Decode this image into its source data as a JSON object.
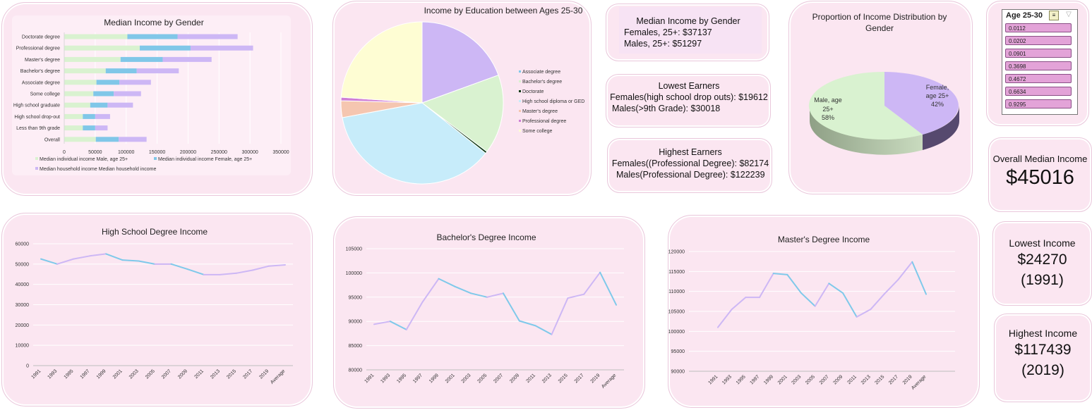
{
  "gender_chart": {
    "title": "Median Income by Gender",
    "categories": [
      "Doctorate degree",
      "Professional degree",
      "Master's degree",
      "Bachelor's degree",
      "Associate degree",
      "Some college",
      "High school graduate",
      "High school drop-out",
      "Less than 9th grade",
      "Overall"
    ],
    "x_ticks": [
      "0",
      "50000",
      "100000",
      "150000",
      "200000",
      "250000",
      "300000",
      "350000"
    ],
    "legend": [
      "Median individual income Male, age 25+",
      "Median individual income Female, age 25+",
      "Median household income Median household income"
    ],
    "colors": [
      "#d9f2d0",
      "#80c7e8",
      "#cdb7f5"
    ]
  },
  "education_pie": {
    "title": "Income by Education between Ages 25-30",
    "legend": [
      "Associate degree",
      "Bachelor's degree",
      "Doctorate",
      "High school diploma or GED",
      "Master's degree",
      "Professional degree",
      "Some college"
    ]
  },
  "median_by_gender": {
    "title": "Median Income by Gender",
    "females": "Females, 25+: $37137",
    "males": "Males, 25+: $51297"
  },
  "lowest_earners": {
    "title": "Lowest Earners",
    "females": "Females(high school drop outs): $19612",
    "males": "Males(>9th Grade): $30018"
  },
  "highest_earners": {
    "title": "Highest Earners",
    "females": "Females((Professional Degree): $82174",
    "males": "Males(Professional Degree): $122239"
  },
  "proportion_pie": {
    "title_line1": "Proportion of Income Distribution by",
    "title_line2": "Gender",
    "male_l1": "Male, age",
    "male_l2": "25+",
    "male_l3": "58%",
    "female_l1": "Female,",
    "female_l2": "age 25+",
    "female_l3": "42%"
  },
  "slicer": {
    "title": "Age 25-30",
    "items": [
      "0.0112",
      "0.0202",
      "0.0901",
      "0.3698",
      "0.4672",
      "0.6634",
      "0.9295"
    ]
  },
  "overall_median": {
    "label": "Overall Median Income",
    "value": "$45016"
  },
  "lowest_income": {
    "label": "Lowest Income",
    "value": "$24270",
    "year": "(1991)"
  },
  "highest_income": {
    "label": "Highest Income",
    "value": "$117439",
    "year": "(2019)"
  },
  "hs_chart": {
    "title": "High School Degree Income",
    "y_ticks": [
      "60000",
      "50000",
      "40000",
      "30000",
      "20000",
      "10000",
      "0"
    ],
    "x_labels": [
      "1991",
      "1993",
      "1995",
      "1997",
      "1999",
      "2001",
      "2003",
      "2005",
      "2007",
      "2009",
      "2011",
      "2013",
      "2015",
      "2017",
      "2019",
      "Average"
    ]
  },
  "ba_chart": {
    "title": "Bachelor's Degree Income",
    "y_ticks": [
      "105000",
      "100000",
      "95000",
      "90000",
      "85000",
      "80000"
    ],
    "x_labels": [
      "1991",
      "1993",
      "1995",
      "1997",
      "1999",
      "2001",
      "2003",
      "2005",
      "2007",
      "2009",
      "2011",
      "2013",
      "2015",
      "2017",
      "2019",
      "Average"
    ]
  },
  "ma_chart": {
    "title": "Master's Degree Income",
    "y_ticks": [
      "120000",
      "115000",
      "110000",
      "105000",
      "100000",
      "95000",
      "90000"
    ],
    "x_labels": [
      "1991",
      "1993",
      "1995",
      "1997",
      "1999",
      "2001",
      "2003",
      "2005",
      "2007",
      "2009",
      "2011",
      "2013",
      "2015",
      "2017",
      "2019",
      "Average"
    ]
  },
  "chart_data": [
    {
      "type": "bar",
      "title": "Median Income by Gender",
      "categories": [
        "Doctorate degree",
        "Professional degree",
        "Master's degree",
        "Bachelor's degree",
        "Associate degree",
        "Some college",
        "High school graduate",
        "High school drop-out",
        "Less than 9th grade",
        "Overall"
      ],
      "series": [
        {
          "name": "Median individual income Male, age 25+",
          "values": [
            102000,
            122000,
            91000,
            67000,
            52000,
            47000,
            42000,
            30000,
            30000,
            51000
          ]
        },
        {
          "name": "Median individual income Female, age 25+",
          "values": [
            81000,
            82000,
            68000,
            50000,
            37000,
            33000,
            28000,
            20000,
            20000,
            37000
          ]
        },
        {
          "name": "Median household income Median household income",
          "values": [
            97000,
            101000,
            79000,
            68000,
            51000,
            44000,
            41000,
            24000,
            20000,
            45000
          ]
        }
      ],
      "xlim": [
        0,
        350000
      ]
    },
    {
      "type": "pie",
      "title": "Income by Education between Ages 25-30",
      "categories": [
        "Associate degree",
        "Bachelor's degree",
        "Doctorate",
        "High school diploma or GED",
        "Master's degree",
        "Professional degree",
        "Some college"
      ],
      "values": [
        0.0112,
        0.0202,
        0.0901,
        0.3698,
        0.4672,
        0.6634,
        0.9295
      ],
      "colors": [
        "#7fc9ea",
        "#d9f2d0",
        "#0f3b17",
        "#c7ecfa",
        "#f5c6b0",
        "#cf7fd6",
        "#fefdd3"
      ]
    },
    {
      "type": "pie",
      "title": "Proportion of Income Distribution by Gender",
      "categories": [
        "Male, age 25+",
        "Female, age 25+"
      ],
      "values": [
        58,
        42
      ],
      "colors": [
        "#d9f2d0",
        "#cdb7f5"
      ]
    },
    {
      "type": "line",
      "title": "High School Degree Income",
      "x": [
        "1991",
        "1993",
        "1995",
        "1997",
        "1999",
        "2001",
        "2003",
        "2005",
        "2007",
        "2009",
        "2011",
        "2013",
        "2015",
        "2017",
        "2019",
        "Average"
      ],
      "values": [
        52500,
        50000,
        52500,
        54000,
        55000,
        52000,
        51500,
        50000,
        50000,
        47500,
        44800,
        44800,
        45500,
        47000,
        49000,
        49600
      ],
      "ylim": [
        0,
        60000
      ]
    },
    {
      "type": "line",
      "title": "Bachelor's Degree Income",
      "x": [
        "1991",
        "1993",
        "1995",
        "1997",
        "1999",
        "2001",
        "2003",
        "2005",
        "2007",
        "2009",
        "2011",
        "2013",
        "2015",
        "2017",
        "2019",
        "Average"
      ],
      "values": [
        89400,
        90000,
        88300,
        94000,
        98800,
        97200,
        95800,
        95000,
        95800,
        90100,
        89100,
        87300,
        94800,
        95600,
        100100,
        93400
      ],
      "ylim": [
        80000,
        105000
      ]
    },
    {
      "type": "line",
      "title": "Master's Degree Income",
      "x": [
        "1991",
        "1993",
        "1995",
        "1997",
        "1999",
        "2001",
        "2003",
        "2005",
        "2007",
        "2009",
        "2011",
        "2013",
        "2015",
        "2017",
        "2019",
        "Average"
      ],
      "values": [
        101000,
        105500,
        108500,
        108500,
        114500,
        114200,
        109600,
        106300,
        112000,
        109600,
        103600,
        105500,
        109400,
        113000,
        117400,
        109300
      ],
      "ylim": [
        90000,
        120000
      ]
    }
  ]
}
